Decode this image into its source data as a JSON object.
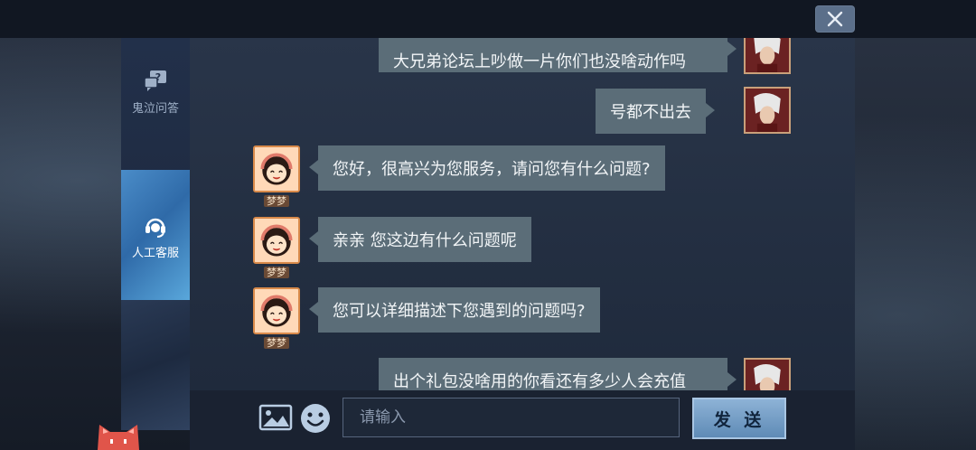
{
  "sidebar": {
    "items": [
      {
        "label": "鬼泣问答",
        "icon": "question-chat-icon"
      },
      {
        "label": "人工客服",
        "icon": "headset-icon"
      }
    ]
  },
  "messages": [
    {
      "side": "right",
      "text": "大兄弟论坛上吵做一片你们也没啥动作吗"
    },
    {
      "side": "right",
      "text": "号都不出去"
    },
    {
      "side": "left",
      "text": "您好，很高兴为您服务，请问您有什么问题?",
      "name": "梦梦"
    },
    {
      "side": "left",
      "text": "亲亲 您这边有什么问题呢",
      "name": "梦梦"
    },
    {
      "side": "left",
      "text": "您可以详细描述下您遇到的问题吗?",
      "name": "梦梦"
    },
    {
      "side": "right",
      "text": "出个礼包没啥用的你看还有多少人会充值"
    }
  ],
  "input": {
    "placeholder": "请输入",
    "value": ""
  },
  "send_label": "发 送",
  "colors": {
    "bubble": "#5b6d78",
    "active_tab": "#3f7fc0",
    "send_button": "#7aa2c9"
  }
}
